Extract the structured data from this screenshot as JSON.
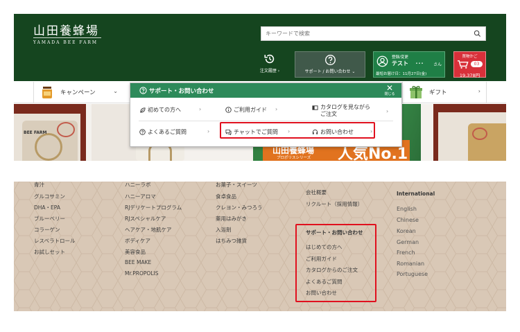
{
  "header": {
    "logo_jp": "山田養蜂場",
    "logo_en": "YAMADA BEE FARM",
    "search_placeholder": "キーワードで検索",
    "history_label": "注文履歴 ›",
    "support_label": "サポート / お問い合わせ ⌄",
    "member": {
      "top": "登録/変更",
      "name": "テスト",
      "dots": "･･･",
      "suffix": "さん",
      "next_delivery": "最短お届け日：11月27日(金)"
    },
    "cart": {
      "label": "買物かご",
      "count": "03",
      "price": "19,378円"
    }
  },
  "global_nav": {
    "items": [
      {
        "label": "キャンペーン",
        "chevron": "⌄"
      },
      {
        "label": "ギフト",
        "chevron": "›"
      }
    ]
  },
  "support_menu": {
    "title": "サポート・お問い合わせ",
    "close": "✕",
    "close_label": "閉じる",
    "row1": [
      {
        "label": "初めての方へ",
        "chevron": "›"
      },
      {
        "label": "ご利用ガイド",
        "chevron": "›"
      },
      {
        "label1": "カタログを見ながら",
        "label2": "ご注文",
        "chevron": "›"
      }
    ],
    "row2": [
      {
        "label": "よくあるご質問",
        "chevron": "›"
      },
      {
        "label": "チャットでご質問",
        "chevron": "›"
      },
      {
        "label": "お問い合わせ",
        "chevron": "›"
      }
    ]
  },
  "hero": {
    "brand": "山田養蜂場",
    "series": "プロポリスシリーズ",
    "badge": "人気No.1",
    "bag_text": "BEE FARM"
  },
  "footer": {
    "col1": [
      "青汁",
      "グルコサミン",
      "DHA・EPA",
      "ブルーベリー",
      "コラーゲン",
      "レスベラトロール",
      "お試しセット"
    ],
    "col2": [
      "ハニーラボ",
      "ハニーアロマ",
      "RJデリケートプログラム",
      "RJスペシャルケア",
      "ヘアケア・地肌ケア",
      "ボディケア",
      "美容食品",
      "BEE MAKE",
      "Mr.PROPOLIS"
    ],
    "col3": [
      "お菓子・スイーツ",
      "食卓食品",
      "クレヨン・みつろう",
      "薬用はみがき",
      "入浴剤",
      "はちみつ雑貨"
    ],
    "col4_top": [
      "会社概要",
      "リクルート（採用情報）"
    ],
    "support_heading": "サポート・お問い合わせ",
    "support_items": [
      "はじめての方へ",
      "ご利用ガイド",
      "カタログからのご注文",
      "よくあるご質問",
      "お問い合わせ"
    ],
    "intl_heading": "International",
    "languages": [
      "English",
      "Chinese",
      "Korean",
      "German",
      "French",
      "Romanian",
      "Portuguese"
    ]
  },
  "colors": {
    "header_green": "#15451f",
    "menu_green": "#2d8a5a",
    "cart_red": "#d8303a",
    "highlight_red": "#e0101e",
    "footer_beige": "#d9c8b6"
  }
}
